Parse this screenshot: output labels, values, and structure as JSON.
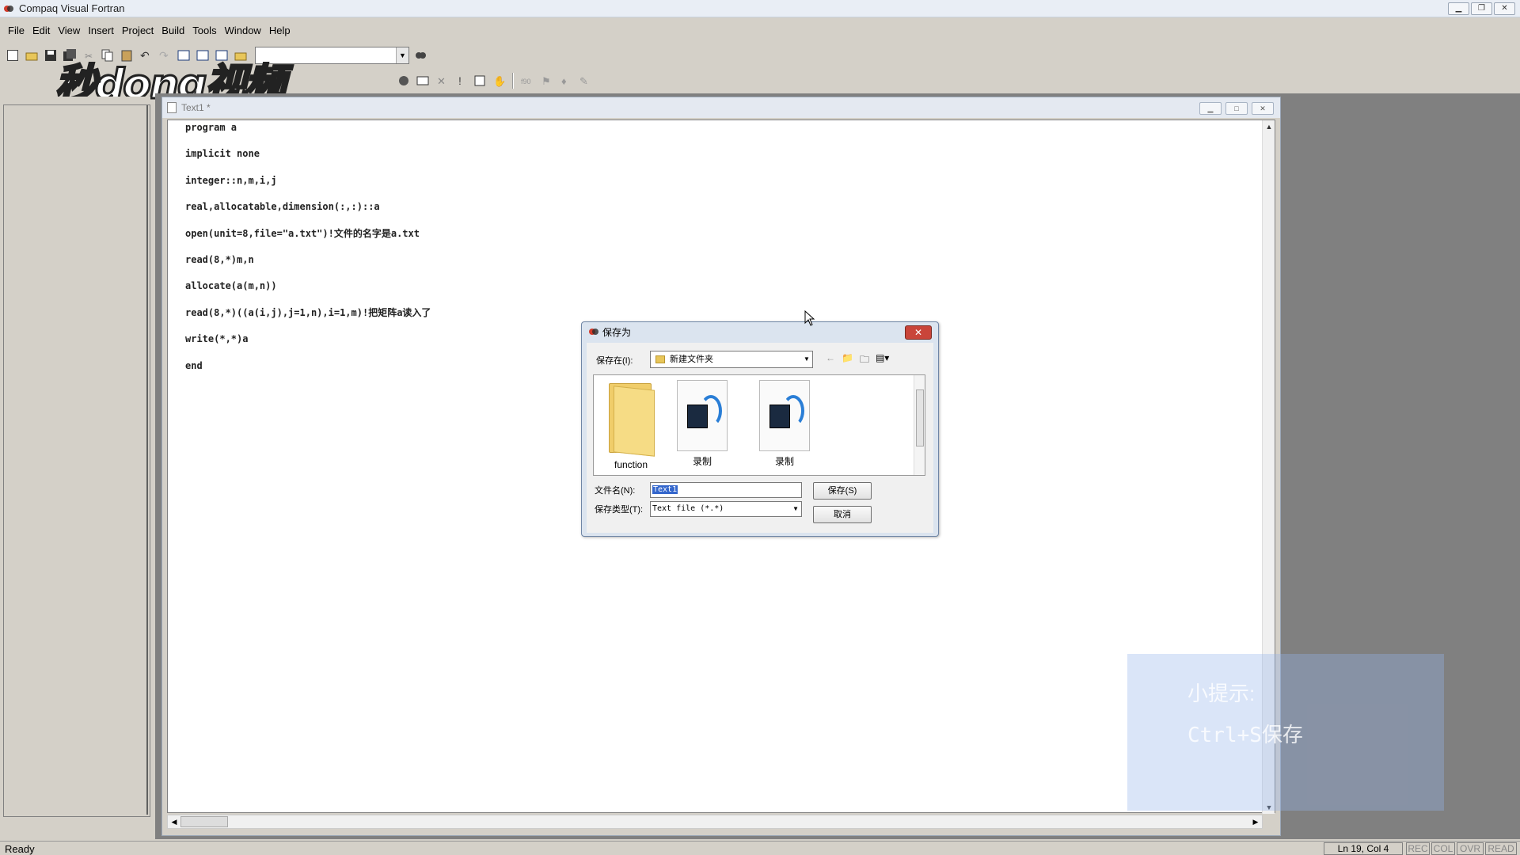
{
  "app": {
    "title": "Compaq Visual Fortran"
  },
  "menu": {
    "items": [
      {
        "label": "File"
      },
      {
        "label": "Edit"
      },
      {
        "label": "View"
      },
      {
        "label": "Insert"
      },
      {
        "label": "Project"
      },
      {
        "label": "Build"
      },
      {
        "label": "Tools"
      },
      {
        "label": "Window"
      },
      {
        "label": "Help"
      }
    ]
  },
  "watermark": {
    "text": "秒dong视频"
  },
  "document": {
    "title": "Text1 *",
    "lines": [
      "program a",
      "implicit none",
      "integer::n,m,i,j",
      "real,allocatable,dimension(:,:)::a",
      "open(unit=8,file=\"a.txt\")!文件的名字是a.txt",
      "read(8,*)m,n",
      "allocate(a(m,n))",
      "read(8,*)((a(i,j),j=1,n),i=1,m)!把矩阵a读入了",
      "write(*,*)a",
      "end"
    ]
  },
  "dialog": {
    "title": "保存为",
    "save_in_label": "保存在(I):",
    "save_in_value": "新建文件夹",
    "files": [
      {
        "name": "function",
        "type": "folder"
      },
      {
        "name": "录制",
        "type": "media"
      },
      {
        "name": "录制",
        "type": "media"
      }
    ],
    "filename_label": "文件名(N):",
    "filename_value": "Text1",
    "filetype_label": "保存类型(T):",
    "filetype_value": "Text file (*.*)",
    "save_button": "保存(S)",
    "cancel_button": "取消"
  },
  "tip": {
    "line1": "小提示:",
    "line2": "Ctrl+S保存"
  },
  "status": {
    "text": "Ready",
    "position": "Ln 19, Col 4",
    "rec": "REC",
    "col": "COL",
    "ovr": "OVR",
    "read": "READ"
  },
  "colors": {
    "accent": "#3366cc",
    "close_red": "#c9453a"
  }
}
